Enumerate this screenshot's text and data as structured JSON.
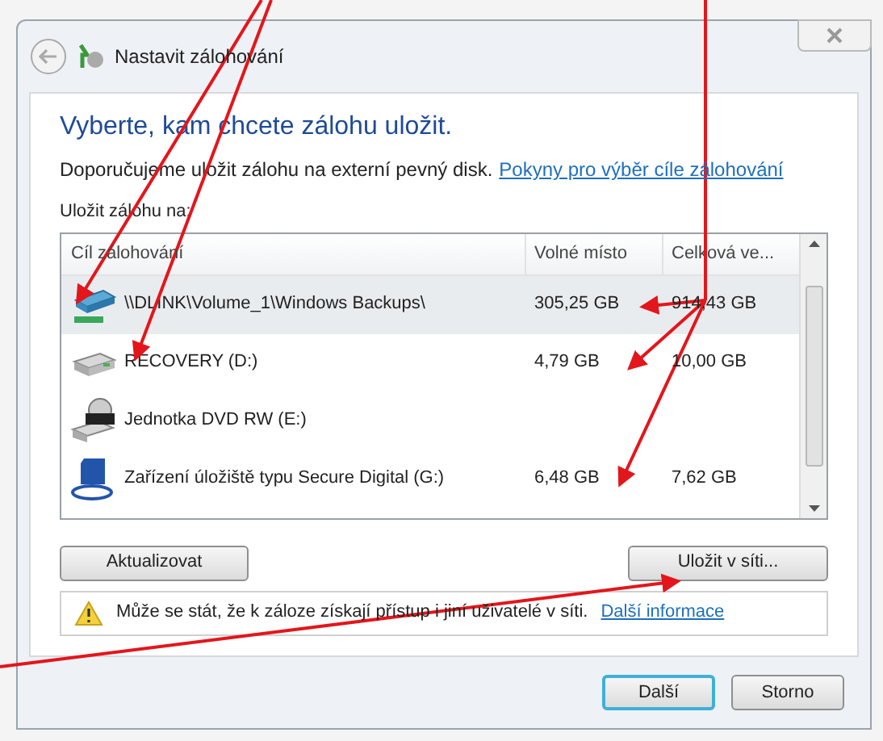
{
  "window": {
    "title": "Nastavit zálohování"
  },
  "heading": "Vyberte, kam chcete zálohu uložit.",
  "recommendation": {
    "text": "Doporučujeme uložit zálohu na externí pevný disk.",
    "link": "Pokyny pro výběr cíle zálohování"
  },
  "list_label": "Uložit zálohu na:",
  "table": {
    "columns": [
      "Cíl zálohování",
      "Volné místo",
      "Celková ve..."
    ],
    "rows": [
      {
        "kind": "network",
        "name": "\\\\DLINK\\Volume_1\\Windows Backups\\",
        "free": "305,25 GB",
        "total": "914,43 GB",
        "selected": true
      },
      {
        "kind": "drive",
        "name": "RECOVERY (D:)",
        "free": "4,79 GB",
        "total": "10,00 GB",
        "selected": false
      },
      {
        "kind": "dvd",
        "name": "Jednotka DVD RW (E:)",
        "selected": false
      },
      {
        "kind": "sd",
        "name": "Zařízení úložiště typu Secure Digital (G:)",
        "free": "6,48 GB",
        "total": "7,62 GB",
        "selected": false
      }
    ]
  },
  "refresh_button": "Aktualizovat",
  "network_button": "Uložit v síti...",
  "warning": {
    "text": "Může se stát, že k záloze získají přístup i jiní uživatelé v síti.",
    "link": "Další informace"
  },
  "buttons": [
    {
      "label": "Další",
      "default": true
    },
    {
      "label": "Storno",
      "default": false
    }
  ]
}
